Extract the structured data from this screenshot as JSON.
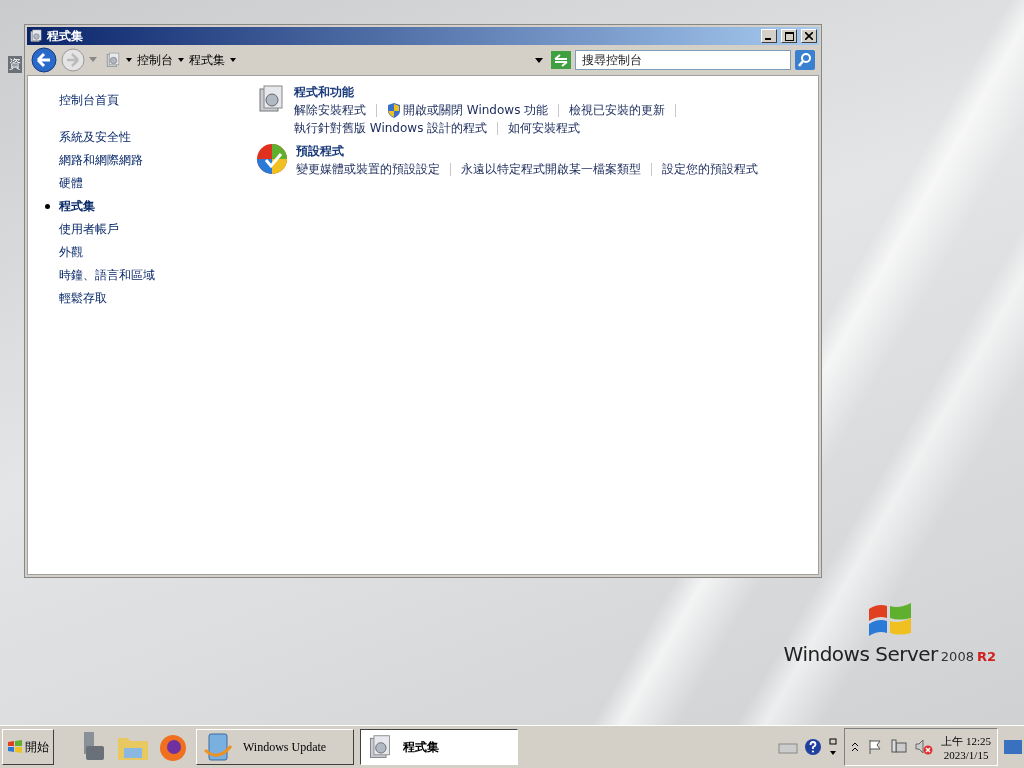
{
  "desktop": {
    "icon_label": "資",
    "logo": {
      "name": "Windows Server",
      "version": "2008",
      "edition": "R2"
    }
  },
  "window": {
    "title": "程式集",
    "breadcrumbs": [
      "控制台",
      "程式集"
    ],
    "search": {
      "placeholder": "搜尋控制台"
    }
  },
  "sidebar": {
    "items": [
      {
        "label": "控制台首頁",
        "selected": false,
        "kind": "home"
      },
      {
        "label": "系統及安全性",
        "selected": false,
        "kind": "category"
      },
      {
        "label": "網路和網際網路",
        "selected": false,
        "kind": "category"
      },
      {
        "label": "硬體",
        "selected": false,
        "kind": "category"
      },
      {
        "label": "程式集",
        "selected": true,
        "kind": "category"
      },
      {
        "label": "使用者帳戶",
        "selected": false,
        "kind": "category"
      },
      {
        "label": "外觀",
        "selected": false,
        "kind": "category"
      },
      {
        "label": "時鐘、語言和區域",
        "selected": false,
        "kind": "category"
      },
      {
        "label": "輕鬆存取",
        "selected": false,
        "kind": "category"
      }
    ]
  },
  "categories": [
    {
      "title": "程式和功能",
      "kind": "programs",
      "rows": [
        [
          {
            "label": "解除安裝程式",
            "shield": false
          },
          {
            "label": "開啟或關閉 Windows 功能",
            "shield": true
          },
          {
            "label": "檢視已安裝的更新",
            "shield": false
          }
        ],
        [
          {
            "label": "執行針對舊版 Windows 設計的程式",
            "shield": false
          },
          {
            "label": "如何安裝程式",
            "shield": false
          }
        ]
      ]
    },
    {
      "title": "預設程式",
      "kind": "defaults",
      "rows": [
        [
          {
            "label": "變更媒體或裝置的預設設定",
            "shield": false
          },
          {
            "label": "永遠以特定程式開啟某一檔案類型",
            "shield": false
          },
          {
            "label": "設定您的預設程式",
            "shield": false
          }
        ]
      ]
    }
  ],
  "taskbar": {
    "start": "開始",
    "tasks": [
      {
        "label": "Windows Update",
        "kind": "update",
        "selected": false
      },
      {
        "label": "程式集",
        "kind": "programs",
        "selected": true
      }
    ],
    "clock": {
      "time": "上午 12:25",
      "date": "2023/1/15"
    }
  }
}
